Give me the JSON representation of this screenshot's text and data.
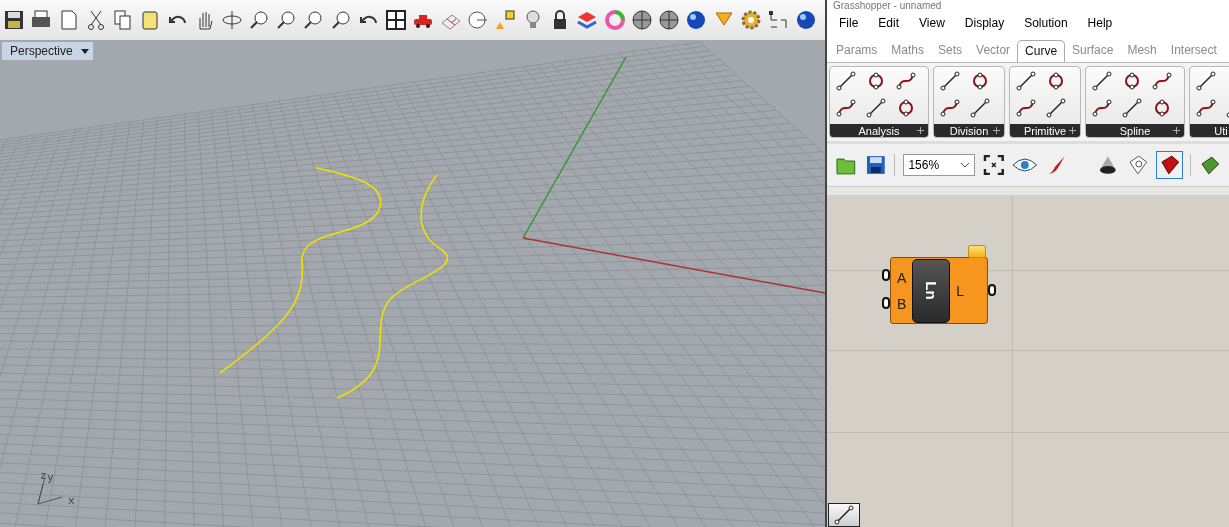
{
  "window": {
    "title": "Grasshopper - unnamed"
  },
  "viewport": {
    "name": "Perspective",
    "axis_labels": [
      "z",
      "y",
      "x"
    ]
  },
  "menu": [
    "File",
    "Edit",
    "View",
    "Display",
    "Solution",
    "Help"
  ],
  "tabs": [
    {
      "label": "Params",
      "selected": false
    },
    {
      "label": "Maths",
      "selected": false
    },
    {
      "label": "Sets",
      "selected": false
    },
    {
      "label": "Vector",
      "selected": false
    },
    {
      "label": "Curve",
      "selected": true
    },
    {
      "label": "Surface",
      "selected": false
    },
    {
      "label": "Mesh",
      "selected": false
    },
    {
      "label": "Intersect",
      "selected": false
    }
  ],
  "ribbon_groups": [
    "Analysis",
    "Division",
    "Primitive",
    "Spline",
    "Uti"
  ],
  "canvas": {
    "zoom": "156%",
    "component": {
      "inputs": [
        "A",
        "B"
      ],
      "name": "Ln",
      "outputs": [
        "L"
      ]
    }
  }
}
